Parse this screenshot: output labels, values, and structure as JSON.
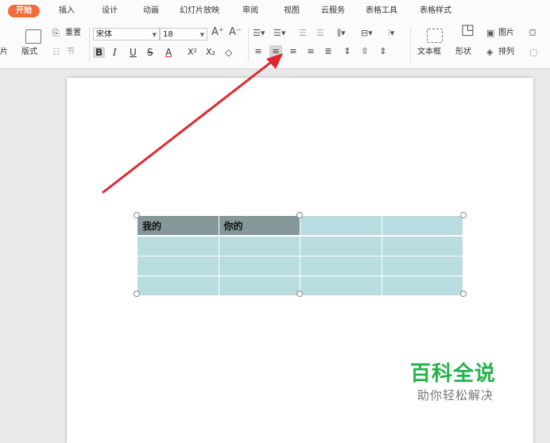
{
  "tabs": [
    {
      "label": "开始",
      "active": true
    },
    {
      "label": "插入"
    },
    {
      "label": "设计"
    },
    {
      "label": "动画"
    },
    {
      "label": "幻灯片放映"
    },
    {
      "label": "审阅"
    },
    {
      "label": "视图"
    },
    {
      "label": "云服务"
    },
    {
      "label": "表格工具"
    },
    {
      "label": "表格样式"
    }
  ],
  "toolbar": {
    "reset_label": "重置",
    "section_label": "节",
    "slide_partial_label": "片",
    "layout_label": "版式",
    "font_name": "宋体",
    "font_size": "18",
    "textbox_label": "文本框",
    "shape_label": "形状",
    "picture_label": "图片",
    "arrange_label": "排列"
  },
  "table": {
    "rows": [
      [
        "我的",
        "你的",
        "",
        ""
      ],
      [
        "",
        "",
        "",
        ""
      ],
      [
        "",
        "",
        "",
        ""
      ],
      [
        "",
        "",
        "",
        ""
      ]
    ]
  },
  "watermark": {
    "title": "百科全说",
    "subtitle": "助你轻松解决"
  },
  "colors": {
    "accent_tab": "#f26b3a",
    "table_header": "#869799",
    "table_body": "#b8dcdf",
    "arrow": "#e0262c",
    "watermark_green": "#22b34a"
  }
}
